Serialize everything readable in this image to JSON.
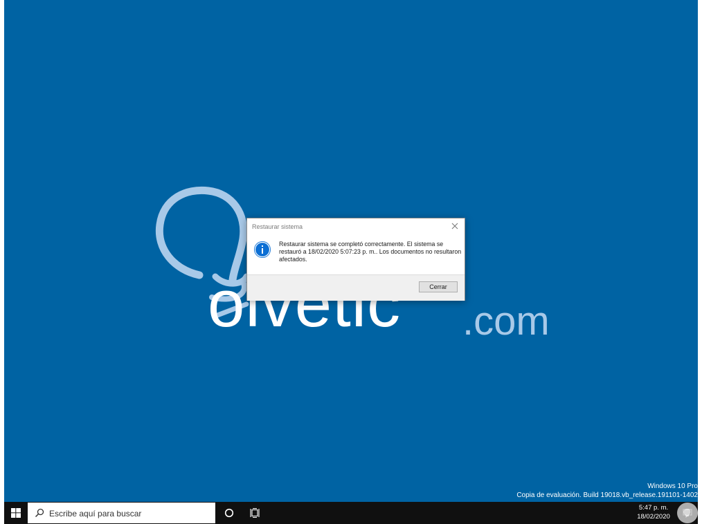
{
  "desktop": {
    "background_color": "#0063a3",
    "watermark": {
      "word": "olvetic",
      "suffix": ".com"
    },
    "activation": {
      "line1": "Windows 10 Pro",
      "line2": "Copia de evaluación. Build 19018.vb_release.191101-1402"
    }
  },
  "dialog": {
    "title": "Restaurar sistema",
    "message": "Restaurar sistema se completó correctamente. El sistema se restauró a 18/02/2020 5:07:23 p. m.. Los documentos no resultaron afectados.",
    "icon": "info-icon",
    "close_icon": "close-icon",
    "buttons": {
      "close_label": "Cerrar"
    }
  },
  "taskbar": {
    "start_icon": "windows-logo-icon",
    "search": {
      "placeholder": "Escribe aquí para buscar",
      "icon": "search-icon"
    },
    "cortana_icon": "cortana-circle-icon",
    "taskview_icon": "task-view-icon",
    "clock": {
      "time": "5:47 p. m.",
      "date": "18/02/2020"
    },
    "notification_icon": "notification-icon",
    "bar_color": "#101010"
  }
}
